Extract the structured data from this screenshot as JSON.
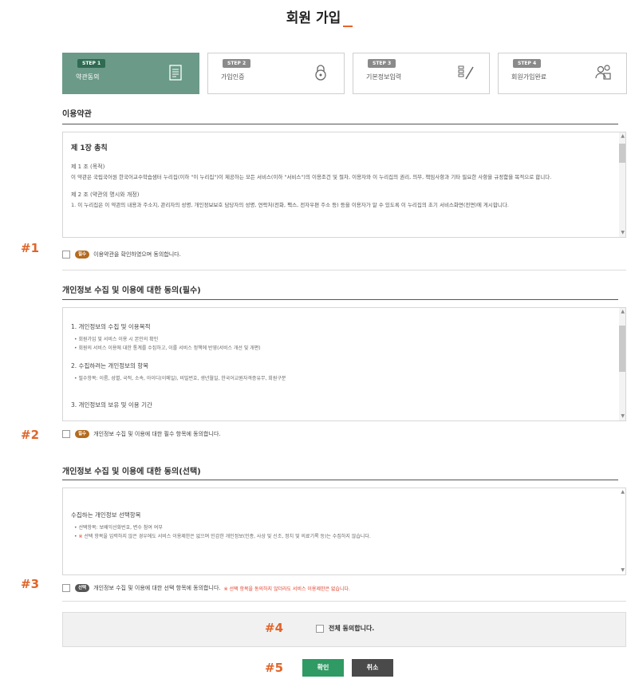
{
  "page": {
    "title": "회원 가입"
  },
  "steps": [
    {
      "badge": "STEP 1",
      "label": "약관동의",
      "icon": "document-icon"
    },
    {
      "badge": "STEP 2",
      "label": "가입인증",
      "icon": "lock-icon"
    },
    {
      "badge": "STEP 3",
      "label": "기본정보입력",
      "icon": "pen-icon"
    },
    {
      "badge": "STEP 4",
      "label": "회원가입완료",
      "icon": "users-icon"
    }
  ],
  "terms": {
    "title": "이용약관",
    "heading": "제 1장 총칙",
    "art1_title": "제 1 조 (목적)",
    "art1_body": "이 약관은 국립국어원 한국어교수학습샘터 누리집(이하 \"이 누리집\")이 제공하는 모든 서비스(이하 \"서비스\")의 이용조건 및 절차, 이용자와 이 누리집의 권리, 의무, 책임사항과 기타 필요한 사항을 규정함을 목적으로 합니다.",
    "art2_title": "제 2 조 (약관의 명시와 개정)",
    "art2_body": "1. 이 누리집은 이 약관의 내용과 주소지, 관리자의 성명, 개인정보보호 담당자의 성명, 연락처(전화, 팩스, 전자우편 주소 등) 등을 이용자가 알 수 있도록 이 누리집의 초기 서비스화면(전면)에 게시합니다.",
    "required_badge": "필수",
    "agree_text": "이용약관을 확인하였으며 동의합니다."
  },
  "privacy_required": {
    "title": "개인정보 수집 및 이용에 대한 동의(필수)",
    "s1_heading": "1. 개인정보의 수집 및 이용목적",
    "s1_b1": "• 회원가입 및 서비스 이용 시 본인의 확인",
    "s1_b2": "• 회원의 서비스 이용에 대한 통계를 수집하고, 이를 서비스 정책에 반영(서비스 개선 및 개편)",
    "s2_heading": "2. 수집하려는 개인정보의 항목",
    "s2_b1": "• 필수항목: 이름, 성별, 국적, 소속, 아이디(이메일), 비밀번호, 생년월일, 한국어교원자격증유무, 회원구분",
    "s3_heading": "3. 개인정보의 보유 및 이용 기간",
    "required_badge": "필수",
    "agree_text": "개인정보 수집 및 이용에 대한 필수 항목에 동의합니다."
  },
  "privacy_optional": {
    "title": "개인정보 수집 및 이용에 대한 동의(선택)",
    "s1_heading": "수집하는 개인정보 선택항목",
    "b1": "• 선택항목: 보배익선화번호, 변수 참여 여부",
    "b2_mark": "※",
    "b2": "선택 항목을 입력하지 않은 경우에도 서비스 이용제한은 없으며 민감한 개인정보(인종, 사상 및 신조, 정치 및 의료기록 등)는 수집하지 않습니다.",
    "optional_badge": "선택",
    "agree_text": "개인정보 수집 및 이용에 대한 선택 항목에 동의합니다.",
    "agree_note": "※ 선택 항목을 동의하지 않더라도 서비스 이용제한은 없습니다."
  },
  "all_agree": {
    "label": "전체 동의합니다."
  },
  "buttons": {
    "confirm": "확인",
    "cancel": "취소"
  },
  "markers": [
    "#1",
    "#2",
    "#3",
    "#4",
    "#5"
  ],
  "colors": {
    "active_step": "#6b9a88",
    "accent": "#e0652a",
    "confirm": "#2f9a63",
    "cancel": "#4a4a4a",
    "required_badge": "#b36a1f"
  }
}
